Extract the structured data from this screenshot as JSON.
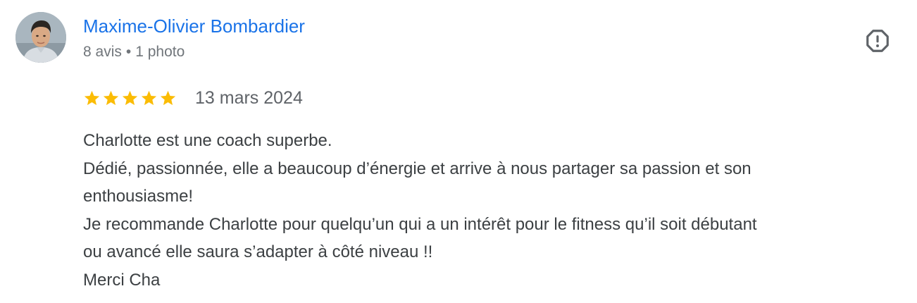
{
  "review": {
    "author": {
      "name": "Maxime-Olivier Bombardier",
      "reviews_count": "8 avis",
      "separator": "•",
      "photos_count": "1 photo",
      "avatar_icon": "person-avatar"
    },
    "rating": {
      "stars": 5,
      "max_stars": 5,
      "star_color": "#fbbc04"
    },
    "date": "13 mars 2024",
    "report_icon": "report-octagon-icon",
    "text_lines": [
      "Charlotte est une coach superbe.",
      "Dédié, passionnée, elle a beaucoup d’énergie et arrive à nous partager sa passion et son",
      "enthousiasme!",
      "Je recommande Charlotte pour quelqu’un qui a un intérêt pour le fitness qu’il soit débutant",
      "ou avancé elle saura s’adapter à côté niveau !!",
      "Merci Cha"
    ]
  },
  "colors": {
    "link": "#1a73e8",
    "meta": "#70757a",
    "text": "#3c4043",
    "icon": "#5f6368"
  }
}
